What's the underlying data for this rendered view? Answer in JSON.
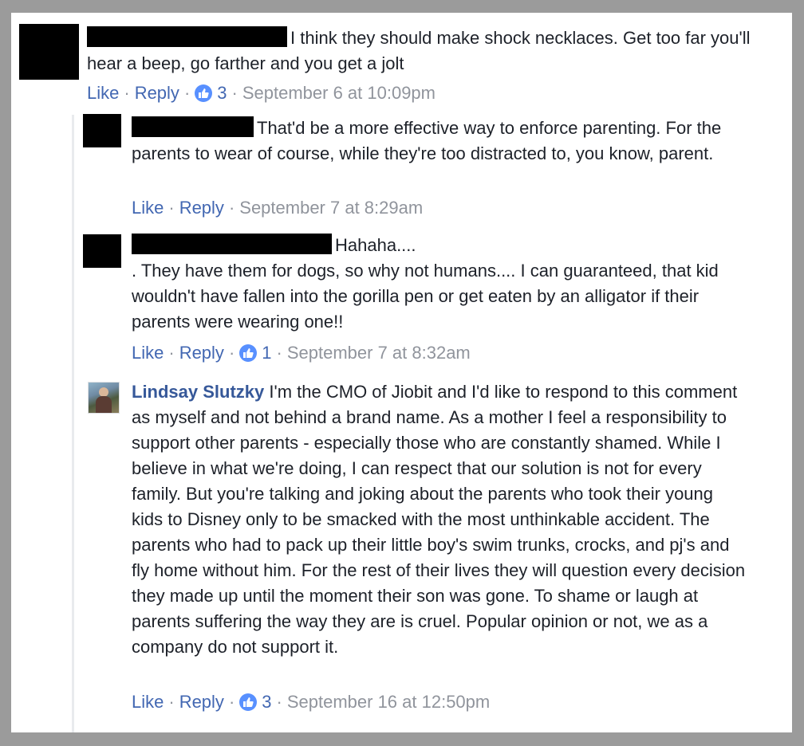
{
  "comments": [
    {
      "author": "",
      "text": "I think they should make shock necklaces. Get too far you'll hear a beep, go farther and you get a jolt",
      "like_label": "Like",
      "reply_label": "Reply",
      "like_count": "3",
      "timestamp": "September 6 at 10:09pm"
    },
    {
      "author": "",
      "text": "That'd be a more effective way to enforce parenting. For the parents to wear of course, while they're too distracted to, you know, parent.",
      "like_label": "Like",
      "reply_label": "Reply",
      "timestamp": "September 7 at 8:29am"
    },
    {
      "author": "",
      "text_line1": "Hahaha....",
      "text_rest": ". They have them for dogs, so why not humans.... I can guaranteed, that kid wouldn't have fallen into the gorilla pen or get eaten by an alligator if their parents were wearing one!!",
      "like_label": "Like",
      "reply_label": "Reply",
      "like_count": "1",
      "timestamp": "September 7 at 8:32am"
    },
    {
      "author": "Lindsay Slutzky",
      "text": "I'm the CMO of Jiobit and I'd like to respond to this comment as myself and not behind a brand name. As a mother I feel a responsibility to support other parents - especially those who are constantly shamed. While I believe in what we're doing, I can respect that our solution is not for every family. But you're talking and joking about the parents who took their young kids to Disney only to be smacked with the most unthinkable accident. The parents who had to pack up their little boy's swim trunks, crocks, and pj's and fly home without him. For the rest of their lives they will question every decision they made up until the moment their son was gone. To shame or laugh at parents suffering the way they are is cruel. Popular opinion or not, we as a company do not support it.",
      "like_label": "Like",
      "reply_label": "Reply",
      "like_count": "3",
      "timestamp": "September 16 at 12:50pm"
    }
  ],
  "separator": "·",
  "colors": {
    "link": "#4267b2",
    "author": "#365899",
    "meta": "#90949c",
    "like_badge": "#5890ff"
  },
  "icons": {
    "like_badge": "thumbs-up-icon"
  }
}
